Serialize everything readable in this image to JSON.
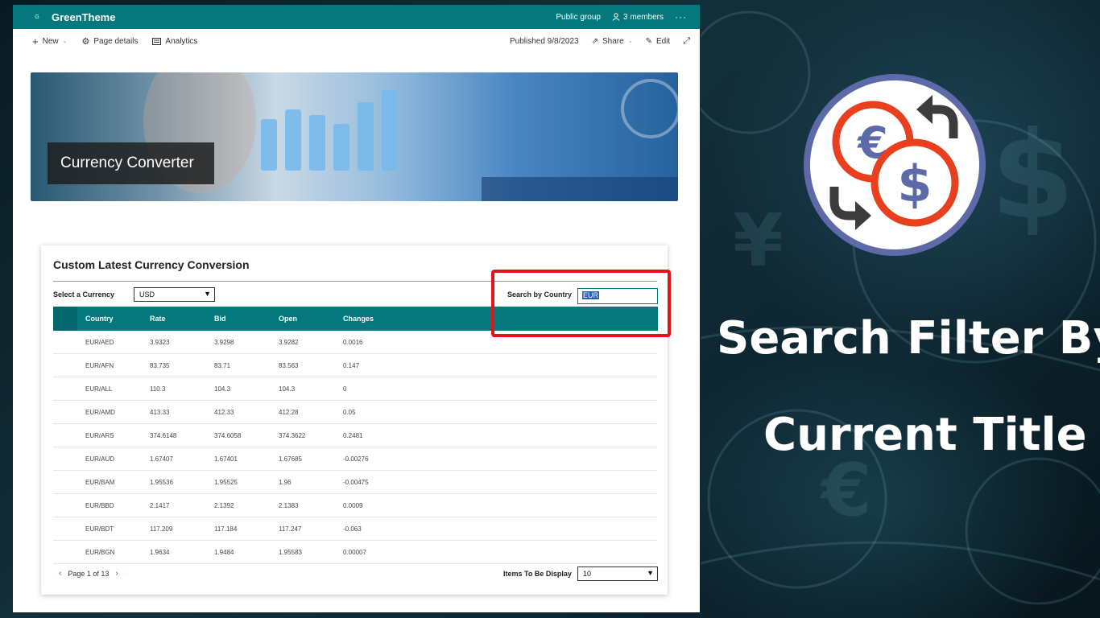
{
  "suite": {
    "logo_letter": "G",
    "site_name": "GreenTheme",
    "group_type": "Public group",
    "members": "3 members",
    "more": "···"
  },
  "command_bar": {
    "new": "New",
    "page_details": "Page details",
    "analytics": "Analytics",
    "published": "Published 9/8/2023",
    "share": "Share",
    "edit": "Edit"
  },
  "hero": {
    "title": "Currency Converter"
  },
  "card": {
    "title": "Custom Latest Currency Conversion",
    "select_label": "Select a Currency",
    "select_value": "USD",
    "search_label": "Search by Country",
    "search_value": "EUR",
    "columns": [
      "Country",
      "Rate",
      "Bid",
      "Open",
      "Changes"
    ],
    "rows": [
      [
        "EUR/AED",
        "3.9323",
        "3.9298",
        "3.9282",
        "0.0016"
      ],
      [
        "EUR/AFN",
        "83.735",
        "83.71",
        "83.563",
        "0.147"
      ],
      [
        "EUR/ALL",
        "110.3",
        "104.3",
        "104.3",
        "0"
      ],
      [
        "EUR/AMD",
        "413.33",
        "412.33",
        "412.28",
        "0.05"
      ],
      [
        "EUR/ARS",
        "374.6148",
        "374.6058",
        "374.3622",
        "0.2481"
      ],
      [
        "EUR/AUD",
        "1.67407",
        "1.67401",
        "1.67685",
        "-0.00276"
      ],
      [
        "EUR/BAM",
        "1.95536",
        "1.95525",
        "1.96",
        "-0.00475"
      ],
      [
        "EUR/BBD",
        "2.1417",
        "2.1392",
        "2.1383",
        "0.0009"
      ],
      [
        "EUR/BDT",
        "117.209",
        "117.184",
        "117.247",
        "-0.063"
      ],
      [
        "EUR/BGN",
        "1.9634",
        "1.9484",
        "1.95583",
        "0.00007"
      ]
    ],
    "pager": "Page 1 of 13",
    "items_label": "Items To Be Display",
    "items_value": "10"
  },
  "headline": {
    "line1": "Search Filter By",
    "line2": "Current Title"
  },
  "colors": {
    "theme": "#04787c",
    "highlight": "#e0151b",
    "logo_ring": "#5d6aa8",
    "coin_red": "#e8401f",
    "coin_symbol": "#5d6aa8"
  }
}
